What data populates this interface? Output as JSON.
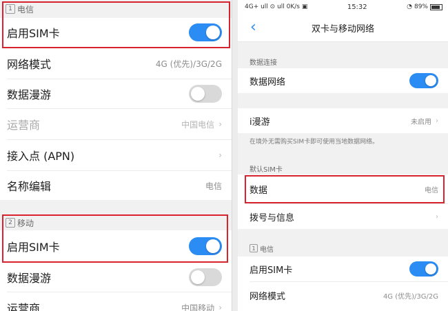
{
  "left": {
    "dx_header": {
      "num": "1",
      "title": "电信"
    },
    "dx_enable": {
      "label": "启用SIM卡"
    },
    "dx_mode": {
      "label": "网络模式",
      "value": "4G (优先)/3G/2G"
    },
    "dx_roam": {
      "label": "数据漫游"
    },
    "dx_carrier": {
      "label": "运营商",
      "value": "中国电信"
    },
    "dx_apn": {
      "label": "接入点 (APN)"
    },
    "dx_name": {
      "label": "名称编辑",
      "value": "电信"
    },
    "yd_header": {
      "num": "2",
      "title": "移动"
    },
    "yd_enable": {
      "label": "启用SIM卡"
    },
    "yd_roam": {
      "label": "数据漫游"
    },
    "yd_carrier": {
      "label": "运营商",
      "value": "中国移动"
    }
  },
  "right": {
    "status": {
      "left": "4G+ ull ⊙ ull 0K/s ▣",
      "time": "15:32",
      "right": "89%"
    },
    "nav": {
      "title": "双卡与移动网络",
      "back_icon": "chevron-left-icon"
    },
    "data_conn": {
      "header": "数据连接",
      "network_label": "数据网络"
    },
    "iroam": {
      "label": "i漫游",
      "value": "未启用",
      "note": "在境外无需购买SIM卡即可使用当地数据网络。"
    },
    "default_sim": {
      "header": "默认SIM卡",
      "data_label": "数据",
      "data_value": "电信",
      "dial_label": "拨号与信息"
    },
    "dx": {
      "num": "1",
      "header": "电信",
      "enable_label": "启用SIM卡",
      "mode_label": "网络模式",
      "mode_value": "4G (优先)/3G/2G"
    }
  },
  "toggles": {
    "left_dx_enable": true,
    "left_dx_roam": false,
    "left_yd_enable": true,
    "left_yd_roam": false,
    "right_data_network": true,
    "right_dx_enable": true
  },
  "colors": {
    "accent": "#2b8cf3",
    "highlight": "#d6232d",
    "toggle_off": "#d9d9d9"
  }
}
